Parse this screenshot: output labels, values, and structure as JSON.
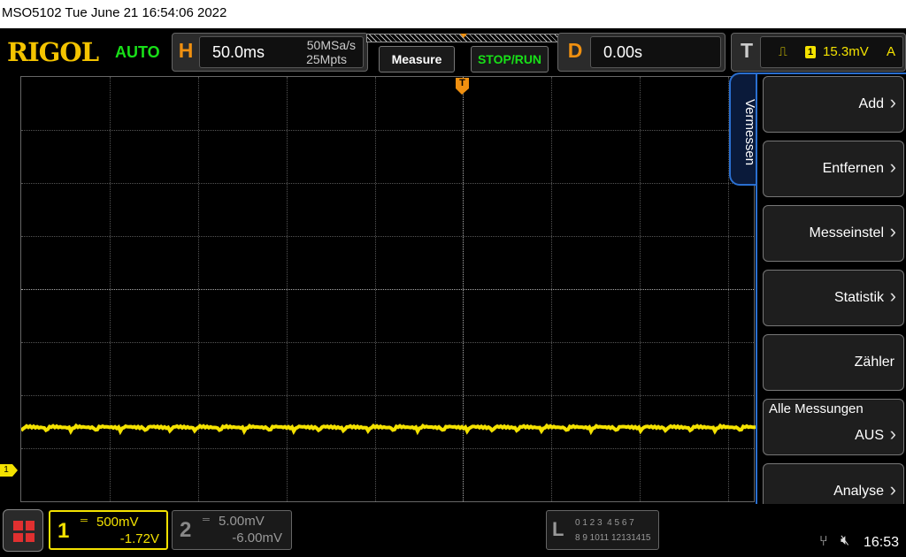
{
  "caption": "MSO5102  Tue June 21 16:54:06 2022",
  "brand": "RIGOL",
  "trigger_mode": "AUTO",
  "horizontal": {
    "key": "H",
    "timebase": "50.0ms",
    "sample_rate": "50MSa/s",
    "memory_depth": "25Mpts"
  },
  "buttons": {
    "measure": "Measure",
    "stop_run": "STOP/RUN"
  },
  "delay": {
    "key": "D",
    "value": "0.00s"
  },
  "trigger": {
    "key": "T",
    "source": "1",
    "level": "15.3mV",
    "coupling": "A",
    "marker": "T"
  },
  "menu_tab": "Vermessen",
  "menu_items": [
    {
      "label": "Add"
    },
    {
      "label": "Entfernen"
    },
    {
      "label": "Messeinstel"
    },
    {
      "label": "Statistik"
    },
    {
      "label": "Zähler"
    },
    {
      "top_label": "Alle Messungen",
      "label": "AUS"
    },
    {
      "label": "Analyse"
    }
  ],
  "channel1": {
    "number": "1",
    "scale": "500mV",
    "offset": "-1.72V",
    "marker": "1",
    "color": "#f4e200"
  },
  "channel2": {
    "number": "2",
    "scale": "5.00mV",
    "offset": "-6.00mV"
  },
  "logic": {
    "key": "L",
    "row1": "0 1 2 3  4 5 6 7",
    "row2": "8 9 1011 12131415"
  },
  "status": {
    "time": "16:53"
  },
  "colors": {
    "accent_blue": "#2a6fd0",
    "trigger_orange": "#f09010",
    "brand_yellow": "#f4c400",
    "status_green": "#18e018"
  }
}
